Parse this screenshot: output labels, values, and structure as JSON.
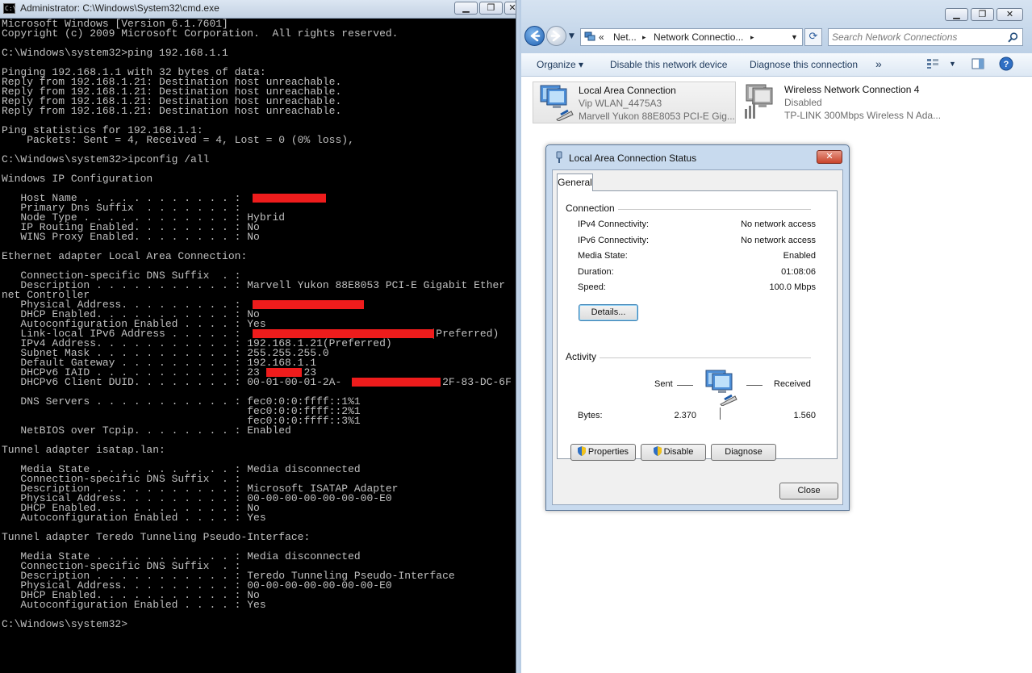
{
  "cmd": {
    "title": "Administrator: C:\\Windows\\System32\\cmd.exe",
    "lines": [
      "Microsoft Windows [Version 6.1.7601]",
      "Copyright (c) 2009 Microsoft Corporation.  All rights reserved.",
      "",
      "C:\\Windows\\system32>ping 192.168.1.1",
      "",
      "Pinging 192.168.1.1 with 32 bytes of data:",
      "Reply from 192.168.1.21: Destination host unreachable.",
      "Reply from 192.168.1.21: Destination host unreachable.",
      "Reply from 192.168.1.21: Destination host unreachable.",
      "Reply from 192.168.1.21: Destination host unreachable.",
      "",
      "Ping statistics for 192.168.1.1:",
      "    Packets: Sent = 4, Received = 4, Lost = 0 (0% loss),",
      "",
      "C:\\Windows\\system32>ipconfig /all",
      "",
      "Windows IP Configuration",
      "",
      "   Host Name . . . . . . . . . . . . : ",
      "   Primary Dns Suffix  . . . . . . . : ",
      "   Node Type . . . . . . . . . . . . : Hybrid",
      "   IP Routing Enabled. . . . . . . . : No",
      "   WINS Proxy Enabled. . . . . . . . : No",
      "",
      "Ethernet adapter Local Area Connection:",
      "",
      "   Connection-specific DNS Suffix  . : ",
      "   Description . . . . . . . . . . . : Marvell Yukon 88E8053 PCI-E Gigabit Ether",
      "net Controller",
      "   Physical Address. . . . . . . . . : ",
      "   DHCP Enabled. . . . . . . . . . . : No",
      "   Autoconfiguration Enabled . . . . : Yes",
      "   Link-local IPv6 Address . . . . . :                              (Preferred)",
      "   IPv4 Address. . . . . . . . . . . : 192.168.1.21(Preferred)",
      "   Subnet Mask . . . . . . . . . . . : 255.255.255.0",
      "   Default Gateway . . . . . . . . . : 192.168.1.1",
      "   DHCPv6 IAID . . . . . . . . . . . : 23       23",
      "   DHCPv6 Client DUID. . . . . . . . : 00-01-00-01-2A-               -2F-83-DC-6F",
      "",
      "   DNS Servers . . . . . . . . . . . : fec0:0:0:ffff::1%1",
      "                                       fec0:0:0:ffff::2%1",
      "                                       fec0:0:0:ffff::3%1",
      "   NetBIOS over Tcpip. . . . . . . . : Enabled",
      "",
      "Tunnel adapter isatap.lan:",
      "",
      "   Media State . . . . . . . . . . . : Media disconnected",
      "   Connection-specific DNS Suffix  . : ",
      "   Description . . . . . . . . . . . : Microsoft ISATAP Adapter",
      "   Physical Address. . . . . . . . . : 00-00-00-00-00-00-00-E0",
      "   DHCP Enabled. . . . . . . . . . . : No",
      "   Autoconfiguration Enabled . . . . : Yes",
      "",
      "Tunnel adapter Teredo Tunneling Pseudo-Interface:",
      "",
      "   Media State . . . . . . . . . . . : Media disconnected",
      "   Connection-specific DNS Suffix  . : ",
      "   Description . . . . . . . . . . . : Teredo Tunneling Pseudo-Interface",
      "   Physical Address. . . . . . . . . : 00-00-00-00-00-00-00-E0",
      "   DHCP Enabled. . . . . . . . . . . : No",
      "   Autoconfiguration Enabled . . . . : Yes",
      "",
      "C:\\Windows\\system32>"
    ]
  },
  "explorer": {
    "address": {
      "overflow": "«",
      "crumb1": "Net...",
      "crumb2": "Network Connectio...",
      "sep": "▸"
    },
    "search_placeholder": "Search Network Connections",
    "commands": {
      "organize": "Organize ▾",
      "disable": "Disable this network device",
      "diagnose": "Diagnose this connection",
      "more": "»"
    },
    "connections": [
      {
        "name": "Local Area Connection",
        "network": "Vip WLAN_4475A3",
        "device": "Marvell Yukon 88E8053 PCI-E Gig..."
      },
      {
        "name": "Wireless Network Connection 4",
        "network": "Disabled",
        "device": "TP-LINK 300Mbps Wireless N Ada..."
      }
    ],
    "accent": "#1e395b"
  },
  "dialog": {
    "title": "Local Area Connection Status",
    "tab": "General",
    "connection": {
      "group": "Connection",
      "rows": [
        {
          "label": "IPv4 Connectivity:",
          "value": "No network access"
        },
        {
          "label": "IPv6 Connectivity:",
          "value": "No network access"
        },
        {
          "label": "Media State:",
          "value": "Enabled"
        },
        {
          "label": "Duration:",
          "value": "01:08:06"
        },
        {
          "label": "Speed:",
          "value": "100.0 Mbps"
        }
      ],
      "details_button": "Details..."
    },
    "activity": {
      "group": "Activity",
      "sent_label": "Sent",
      "received_label": "Received",
      "bytes_label": "Bytes:",
      "sent_bytes": "2.370",
      "received_bytes": "1.560"
    },
    "buttons": {
      "properties": "Properties",
      "disable": "Disable",
      "diagnose": "Diagnose",
      "close": "Close"
    }
  }
}
